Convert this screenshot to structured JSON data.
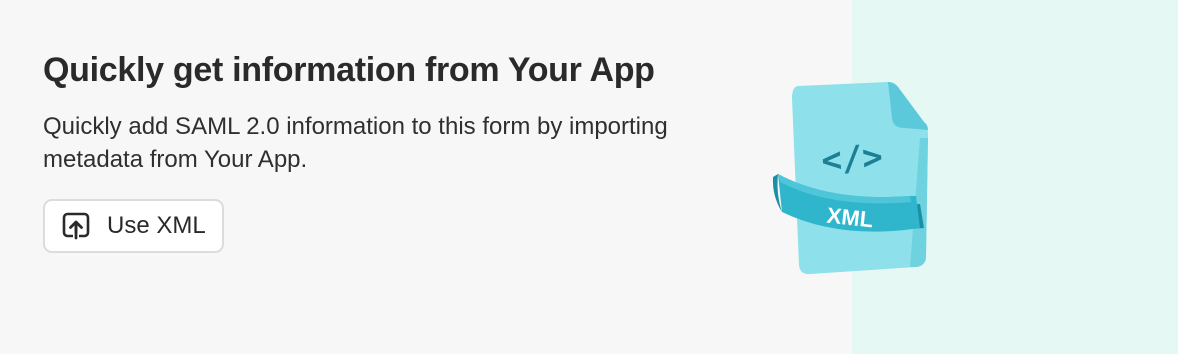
{
  "card": {
    "title": "Quickly get information from Your App",
    "description": "Quickly add SAML 2.0 information to this form by importing metadata from Your App.",
    "button_label": "Use XML",
    "button_icon": "upload-icon"
  },
  "illustration": {
    "icon": "xml-file-icon",
    "code_glyph": "</>",
    "ribbon_label": "XML"
  },
  "colors": {
    "card_background": "#f7f7f7",
    "illustration_panel": "#e6f8f4",
    "file_light": "#8ee0ea",
    "file_mid": "#5cc9da",
    "ribbon": "#2fb6cc",
    "ribbon_dark": "#1b8fa5",
    "code_glyph": "#1c7f94"
  }
}
